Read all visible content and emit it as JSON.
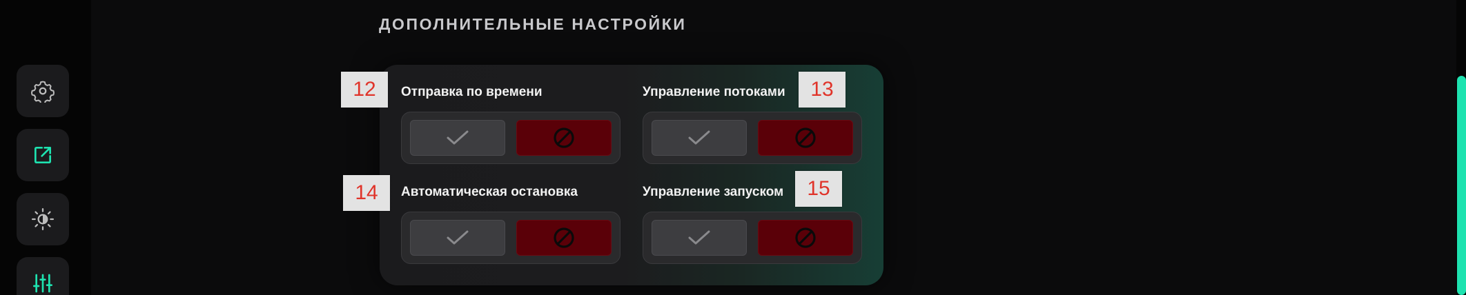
{
  "section": {
    "title": "ДОПОЛНИТЕЛЬНЫЕ НАСТРОЙКИ"
  },
  "sidebar": {
    "items": [
      {
        "icon": "gear-icon",
        "active": false
      },
      {
        "icon": "external-link-icon",
        "active": true
      },
      {
        "icon": "brightness-icon",
        "active": false
      },
      {
        "icon": "sliders-icon",
        "active": true
      }
    ],
    "accent_color": "#1ee3b0"
  },
  "settings": [
    {
      "label": "Отправка по времени",
      "badge": "12",
      "yes_icon": "check-icon",
      "no_icon": "forbidden-icon"
    },
    {
      "label": "Управление потоками",
      "badge": "13",
      "yes_icon": "check-icon",
      "no_icon": "forbidden-icon"
    },
    {
      "label": "Автоматическая остановка",
      "badge": "14",
      "yes_icon": "check-icon",
      "no_icon": "forbidden-icon"
    },
    {
      "label": "Управление запуском",
      "badge": "15",
      "yes_icon": "check-icon",
      "no_icon": "forbidden-icon"
    }
  ],
  "colors": {
    "deny_active": "#5a0008",
    "allow_inactive": "#3d3d40",
    "badge_text": "#e0342a"
  }
}
